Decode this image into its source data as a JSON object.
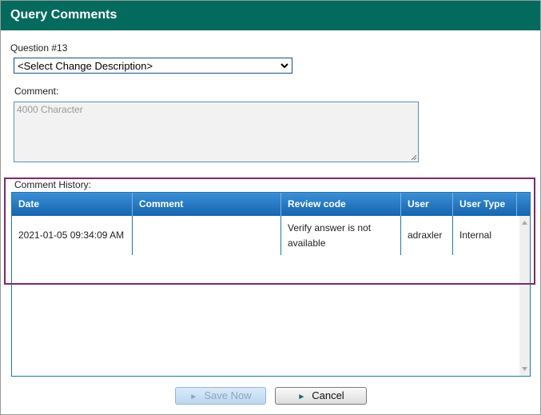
{
  "dialog": {
    "title": "Query Comments",
    "question_label": "Question #13",
    "select": {
      "value": "<Select Change Description>",
      "icon": "chevron-down-icon"
    },
    "comment_label": "Comment:",
    "comment_placeholder": "4000 Character",
    "history_label": "Comment History:",
    "history": {
      "columns": [
        "Date",
        "Comment",
        "Review code",
        "User",
        "User Type"
      ],
      "rows": [
        {
          "date": "2021-01-05 09:34:09 AM",
          "comment": "",
          "review_code_line1": "Verify answer is not",
          "review_code_line2": "available",
          "user": "adraxler",
          "user_type": "Internal"
        }
      ]
    },
    "buttons": {
      "save_label": "Save Now",
      "cancel_label": "Cancel"
    }
  },
  "colors": {
    "titlebar": "#036b5e",
    "grid_header": "#1565b0",
    "highlight_border": "#7b2a6e"
  }
}
